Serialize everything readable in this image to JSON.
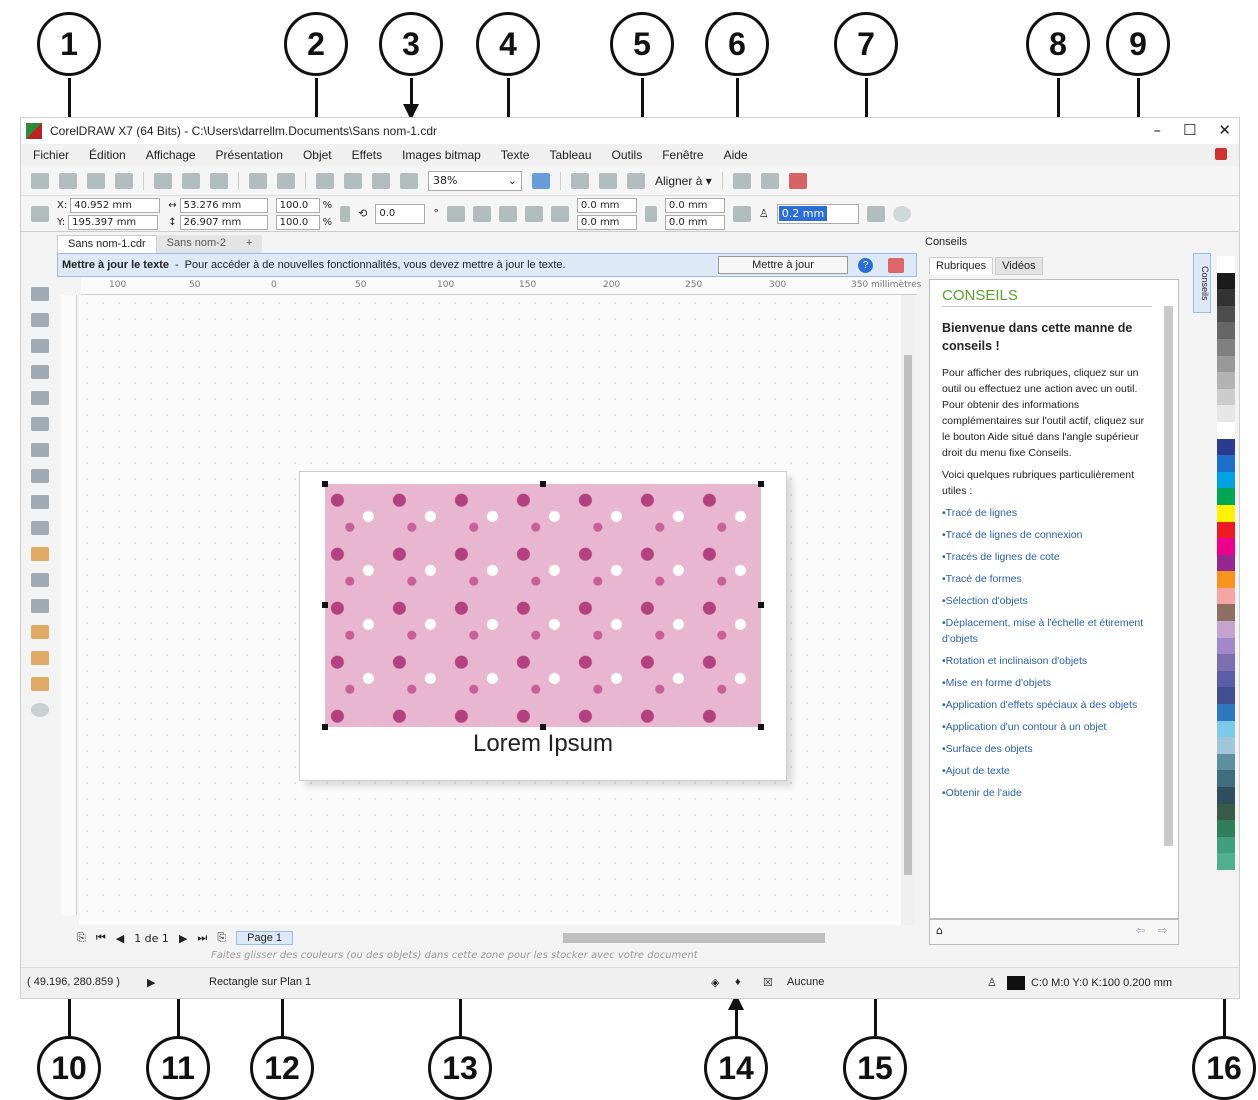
{
  "callouts": {
    "n1": "1",
    "n2": "2",
    "n3": "3",
    "n4": "4",
    "n5": "5",
    "n6": "6",
    "n7": "7",
    "n8": "8",
    "n9": "9",
    "n10": "10",
    "n11": "11",
    "n12": "12",
    "n13": "13",
    "n14": "14",
    "n15": "15",
    "n16": "16"
  },
  "titlebar": {
    "title": "CorelDRAW X7 (64 Bits) - C:\\Users\\darrellm.Documents\\Sans nom-1.cdr",
    "minimize": "–",
    "maximize": "☐",
    "close": "✕"
  },
  "menu": [
    "Fichier",
    "Édition",
    "Affichage",
    "Présentation",
    "Objet",
    "Effets",
    "Images bitmap",
    "Texte",
    "Tableau",
    "Outils",
    "Fenêtre",
    "Aide"
  ],
  "toolbar": {
    "zoom": "38%",
    "align": "Aligner à ▾"
  },
  "propbar": {
    "x_label": "X:",
    "x": "40.952 mm",
    "y_label": "Y:",
    "y": "195.397 mm",
    "w": "53.276 mm",
    "h": "26.907 mm",
    "sx": "100.0",
    "sy": "100.0",
    "pct": "%",
    "angle": "0.0",
    "deg": "°",
    "c1": "0.0 mm",
    "c2": "0.0 mm",
    "c3": "0.0 mm",
    "c4": "0.0 mm",
    "outline": "0.2 mm"
  },
  "doctabs": [
    "Sans nom-1.cdr",
    "Sans nom-2"
  ],
  "notif": {
    "title": "Mettre à jour le texte",
    "sep": "-",
    "message": "Pour accéder à de nouvelles fonctionnalités, vous devez mettre à jour le texte.",
    "button": "Mettre à jour",
    "help": "?"
  },
  "ruler": {
    "h_ticks": [
      "100",
      "50",
      "0",
      "50",
      "100",
      "150",
      "200",
      "250",
      "300",
      "350"
    ],
    "unit": "millimètres"
  },
  "canvas": {
    "lorem": "Lorem Ipsum"
  },
  "docnav": {
    "pages": "1 de 1",
    "page_tab": "Page 1"
  },
  "colorwell": "Faites glisser des couleurs (ou des objets) dans cette zone pour les stocker avec votre document",
  "status": {
    "coords": "( 49.196, 280.859 )",
    "object": "Rectangle sur Plan 1",
    "fill": "Aucune",
    "outline": "C:0 M:0 Y:0 K:100  0.200 mm"
  },
  "docker": {
    "title": "Conseils",
    "tab1": "Rubriques",
    "tab2": "Vidéos",
    "heading": "CONSEILS",
    "welcome": "Bienvenue dans cette manne de conseils !",
    "para1": "Pour afficher des rubriques, cliquez sur un outil ou effectuez une action avec un outil. Pour obtenir des informations complémentaires sur l'outil actif, cliquez sur le bouton Aide situé dans l'angle supérieur droit du menu fixe Conseils.",
    "para2": "Voici quelques rubriques particulièrement utiles :",
    "topics": [
      "•Tracé de lignes",
      "•Tracé de lignes de connexion",
      "•Tracés de lignes de cote",
      "•Tracé de formes",
      "•Sélection d'objets",
      "•Déplacement, mise à l'échelle et étirement d'objets",
      "•Rotation et inclinaison d'objets",
      "•Mise en forme d'objets",
      "•Application d'effets spéciaux à des objets",
      "•Application d'un contour à un objet",
      "•Surface des objets",
      "•Ajout de texte",
      "•Obtenir de l'aide"
    ],
    "side_tab": "Conseils"
  },
  "colors": {
    "accent": "#2b6fd6",
    "palette": [
      "#ffffff",
      "#1a1a1a",
      "#333333",
      "#4d4d4d",
      "#666666",
      "#808080",
      "#999999",
      "#b3b3b3",
      "#cccccc",
      "#e6e6e6",
      "#ffffff",
      "#2b3b8f",
      "#1e6fc7",
      "#00a3e0",
      "#00a651",
      "#fff200",
      "#ed1c24",
      "#ec008c",
      "#92278f",
      "#f7941d",
      "#f4a6a6",
      "#8c6e63",
      "#c5a3cf",
      "#a088c9",
      "#7b6fb0",
      "#5b5ea6",
      "#3f4f8f",
      "#2f78bf",
      "#7ec8e8",
      "#9fc7d8",
      "#5f8f9e",
      "#3f6f7e",
      "#2f4f5e",
      "#3a5a4a",
      "#2f7f5f",
      "#3f9f7f",
      "#4faf8f"
    ]
  }
}
